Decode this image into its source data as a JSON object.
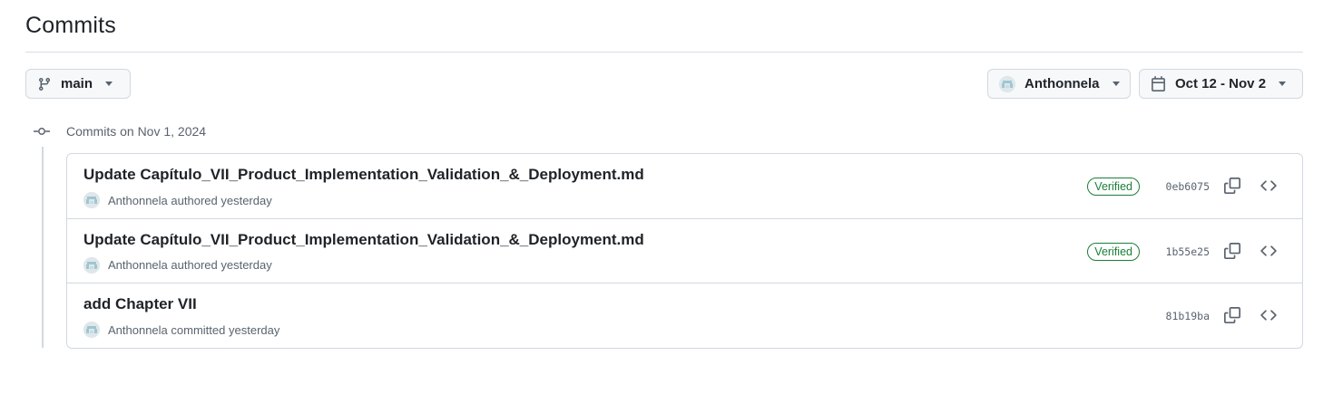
{
  "page": {
    "title": "Commits"
  },
  "filters": {
    "branch": {
      "label": "main",
      "icon": "git-branch-icon"
    },
    "author": {
      "label": "Anthonnela",
      "icon": "avatar"
    },
    "date_range": {
      "label": "Oct 12 - Nov 2",
      "icon": "calendar-icon"
    }
  },
  "groups": [
    {
      "label": "Commits on Nov 1, 2024",
      "commits": [
        {
          "title": "Update Capítulo_VII_Product_Implementation_Validation_&_Deployment.md",
          "author": "Anthonnela",
          "action": "authored",
          "time": "yesterday",
          "verified": true,
          "verified_label": "Verified",
          "sha": "0eb6075"
        },
        {
          "title": "Update Capítulo_VII_Product_Implementation_Validation_&_Deployment.md",
          "author": "Anthonnela",
          "action": "authored",
          "time": "yesterday",
          "verified": true,
          "verified_label": "Verified",
          "sha": "1b55e25"
        },
        {
          "title": "add Chapter VII",
          "author": "Anthonnela",
          "action": "committed",
          "time": "yesterday",
          "verified": false,
          "verified_label": "",
          "sha": "81b19ba"
        }
      ]
    }
  ],
  "colors": {
    "verified": "#1a7f37",
    "border": "#d1d9e0",
    "muted_text": "#59636e"
  }
}
